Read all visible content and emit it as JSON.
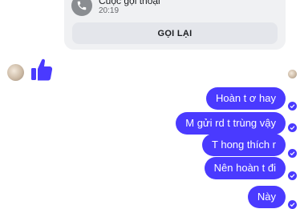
{
  "call_card": {
    "title": "Cuộc gọi thoại",
    "time": "20:19",
    "call_back_label": "GỌI LẠI",
    "icon": "phone-icon"
  },
  "incoming": {
    "icon": "thumbs-up-icon"
  },
  "outgoing": [
    {
      "text": "Hoàn t ơ hay"
    },
    {
      "text": "M gửi rd t trùng vậy"
    },
    {
      "text": "T hong thích r"
    },
    {
      "text": "Nên hoàn t đi"
    },
    {
      "text": "Này"
    }
  ],
  "colors": {
    "bubble": "#4a3aff",
    "card": "#f0f1f3",
    "button": "#e4e6eb"
  }
}
